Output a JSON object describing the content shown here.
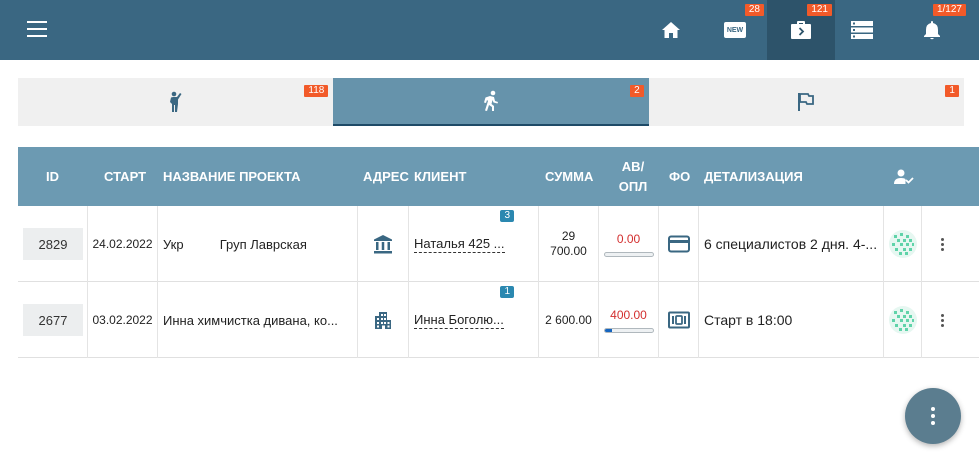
{
  "topbar": {
    "menu_icon": "hamburger-icon",
    "nav": [
      {
        "icon": "home-icon",
        "badge": ""
      },
      {
        "icon": "new-icon",
        "badge": "28",
        "icon_text": "NEW"
      },
      {
        "icon": "briefcase-icon",
        "badge": "121"
      },
      {
        "icon": "server-list-icon",
        "badge": ""
      },
      {
        "icon": "bell-icon",
        "badge": "1/127"
      }
    ]
  },
  "tabs": [
    {
      "icon": "person-standing-icon",
      "badge": "118"
    },
    {
      "icon": "person-running-icon",
      "badge": "2"
    },
    {
      "icon": "flag-icon",
      "badge": "1"
    }
  ],
  "table": {
    "headers": {
      "id": "ID",
      "start": "СТАРТ",
      "name": "НАЗВАНИЕ ПРОЕКТА",
      "address": "АДРЕС",
      "client": "КЛИЕНТ",
      "sum": "СУММА",
      "av_line1": "АВ/",
      "av_line2": "ОПЛ",
      "fo": "ФО",
      "detail": "ДЕТАЛИЗАЦИЯ"
    },
    "rows": [
      {
        "id": "2829",
        "start": "24.02.2022",
        "name": "Укр          Груп Лаврская",
        "address_icon": "bank-icon",
        "client": "Наталья 425 ...",
        "client_badge": "3",
        "sum_line1": "29",
        "sum_line2": "700.00",
        "paid": "0.00",
        "paid_fraction": 0,
        "fo_icon": "credit-card-icon",
        "detail": "6 специалистов 2 дня. 4-..."
      },
      {
        "id": "2677",
        "start": "03.02.2022",
        "name": "Инна химчистка дивана, ко...",
        "address_icon": "apartment-icon",
        "client": "Инна Боголю...",
        "client_badge": "1",
        "sum_line1": "2 600.00",
        "sum_line2": "",
        "paid": "400.00",
        "paid_fraction": 0.15,
        "fo_icon": "cash-icon",
        "detail": "Старт в 18:00"
      }
    ]
  },
  "colors": {
    "topbar": "#3a6782",
    "badge": "#f25a29",
    "header": "#6c9ab2",
    "active_tab": "#6693ab"
  }
}
